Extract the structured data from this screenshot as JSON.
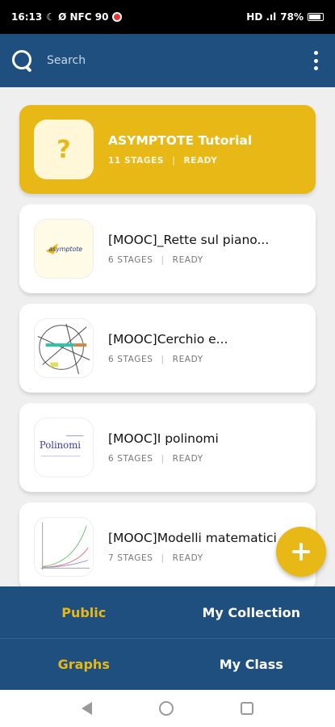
{
  "status_bar": {
    "time": "16:13",
    "left_indicators": "☾ Ø NFC 90",
    "right_indicators": "HD .ıl",
    "battery": "78%"
  },
  "app_bar": {
    "search_placeholder": "Search"
  },
  "cards": [
    {
      "title": "ASYMPTOTE Tutorial",
      "stages": "11 STAGES",
      "status": "READY",
      "thumb": "?"
    },
    {
      "title": "[MOOC]_Rette sul piano...",
      "stages": "6 STAGES",
      "status": "READY",
      "thumb_label": "asymptote"
    },
    {
      "title": "[MOOC]Cerchio e...",
      "stages": "6 STAGES",
      "status": "READY"
    },
    {
      "title": "[MOOC]I polinomi",
      "stages": "6 STAGES",
      "status": "READY",
      "thumb_label": "Polinomi"
    },
    {
      "title": "[MOOC]Modelli matematici",
      "stages": "7 STAGES",
      "status": "READY"
    }
  ],
  "bottom_nav": {
    "public": "Public",
    "my_collection": "My Collection",
    "graphs": "Graphs",
    "my_class": "My Class"
  },
  "colors": {
    "primary": "#1e4f7f",
    "accent": "#e8b817"
  }
}
